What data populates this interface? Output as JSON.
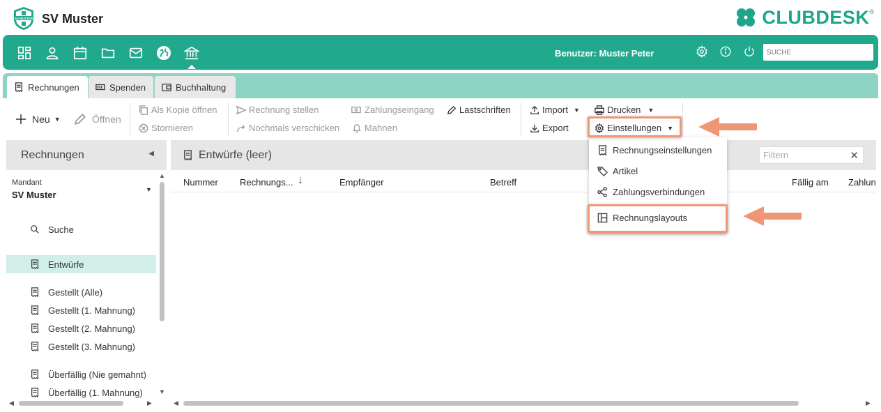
{
  "header": {
    "club_name": "SV Muster",
    "club_logo_text": "SV MUSTER",
    "brand_name": "CLUBDESK",
    "brand_reg": "®"
  },
  "navbar": {
    "user_label": "Benutzer: Muster Peter",
    "search_placeholder": "SUCHE",
    "icons": [
      "dashboard-icon",
      "person-icon",
      "calendar-icon",
      "folder-icon",
      "mail-icon",
      "globe-icon",
      "bank-icon"
    ],
    "right_icons": [
      "gear-icon",
      "info-icon",
      "power-icon"
    ]
  },
  "tabs": [
    {
      "label": "Rechnungen",
      "icon": "invoice-icon",
      "active": true
    },
    {
      "label": "Spenden",
      "icon": "money-icon",
      "active": false
    },
    {
      "label": "Buchhaltung",
      "icon": "wallet-icon",
      "active": false
    }
  ],
  "toolbar": {
    "neu": "Neu",
    "oeffnen": "Öffnen",
    "als_kopie": "Als Kopie öffnen",
    "stornieren": "Stornieren",
    "rechnung_stellen": "Rechnung stellen",
    "nochmals_verschicken": "Nochmals verschicken",
    "zahlungseingang": "Zahlungseingang",
    "mahnen": "Mahnen",
    "lastschriften": "Lastschriften",
    "import": "Import",
    "export": "Export",
    "drucken": "Drucken",
    "einstellungen": "Einstellungen"
  },
  "sidebar": {
    "title": "Rechnungen",
    "mandant_label": "Mandant",
    "mandant_value": "SV Muster",
    "items": [
      {
        "label": "Suche",
        "icon": "search-icon"
      },
      {
        "label": "Entwürfe",
        "icon": "invoice-icon",
        "active": true
      },
      {
        "label": "Gestellt (Alle)",
        "icon": "invoice-icon"
      },
      {
        "label": "Gestellt (1. Mahnung)",
        "icon": "invoice-icon"
      },
      {
        "label": "Gestellt (2. Mahnung)",
        "icon": "invoice-icon"
      },
      {
        "label": "Gestellt (3. Mahnung)",
        "icon": "invoice-icon"
      },
      {
        "label": "Überfällig (Nie gemahnt)",
        "icon": "invoice-icon"
      },
      {
        "label": "Überfällig (1. Mahnung)",
        "icon": "invoice-icon"
      }
    ]
  },
  "main": {
    "title": "Entwürfe (leer)",
    "filter_placeholder": "Filtern",
    "columns": [
      "Nummer",
      "Rechnungs...",
      "Empfänger",
      "Betreff",
      "Fällig am",
      "Zahlun"
    ]
  },
  "dropdown": {
    "items": [
      {
        "label": "Rechnungseinstellungen",
        "icon": "invoice-icon"
      },
      {
        "label": "Artikel",
        "icon": "tag-icon"
      },
      {
        "label": "Zahlungsverbindungen",
        "icon": "share-icon"
      },
      {
        "label": "Rechnungslayouts",
        "icon": "layout-icon"
      }
    ]
  },
  "colors": {
    "primary": "#21a98e",
    "tabbar": "#8ed3c4",
    "highlight": "#ef9775",
    "active_row": "#d2eee8"
  }
}
